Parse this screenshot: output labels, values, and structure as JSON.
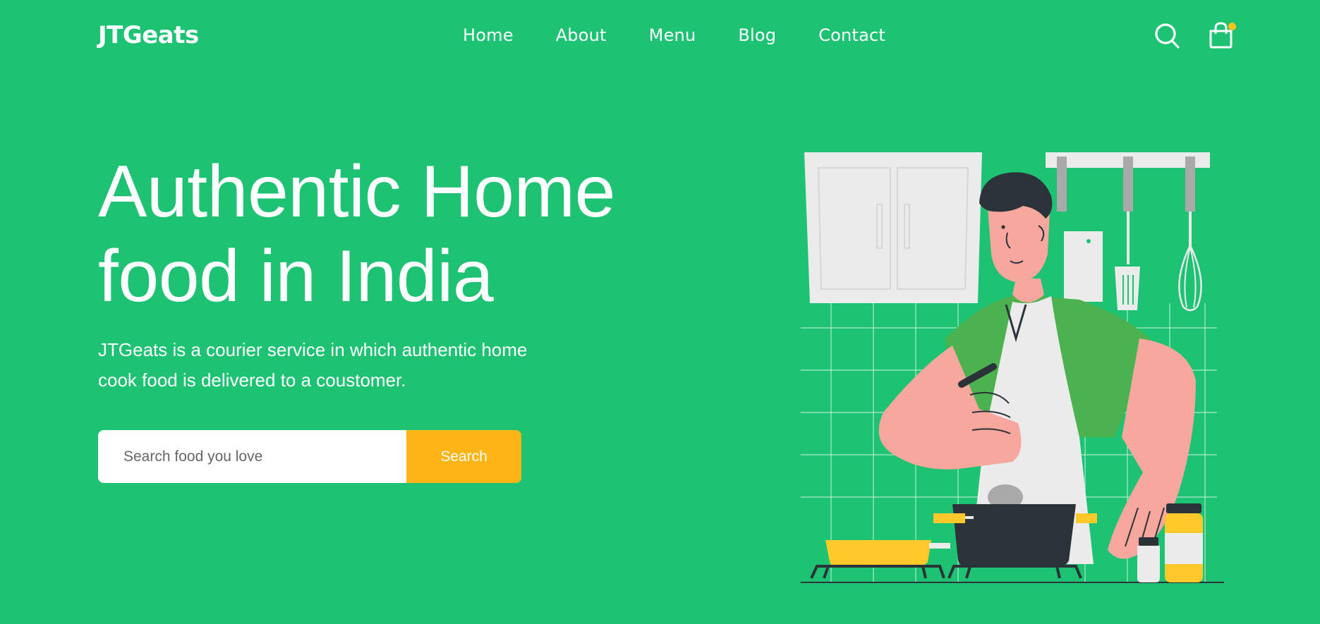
{
  "header": {
    "logo": "JTGeats",
    "nav": [
      "Home",
      "About",
      "Menu",
      "Blog",
      "Contact"
    ],
    "icons": {
      "search": "search-icon",
      "cart": "shopping-bag-icon"
    }
  },
  "hero": {
    "title_line1": "Authentic Home",
    "title_line2": "food in India",
    "description_line1": "JTGeats is a courier service in which authentic home",
    "description_line2": "cook food is delivered to a coustomer.",
    "search": {
      "placeholder": "Search food you love",
      "button_label": "Search"
    }
  },
  "colors": {
    "background": "#1dc273",
    "accent": "#ffb515",
    "text": "#ffffff"
  },
  "illustration": "chef-cooking-illustration"
}
